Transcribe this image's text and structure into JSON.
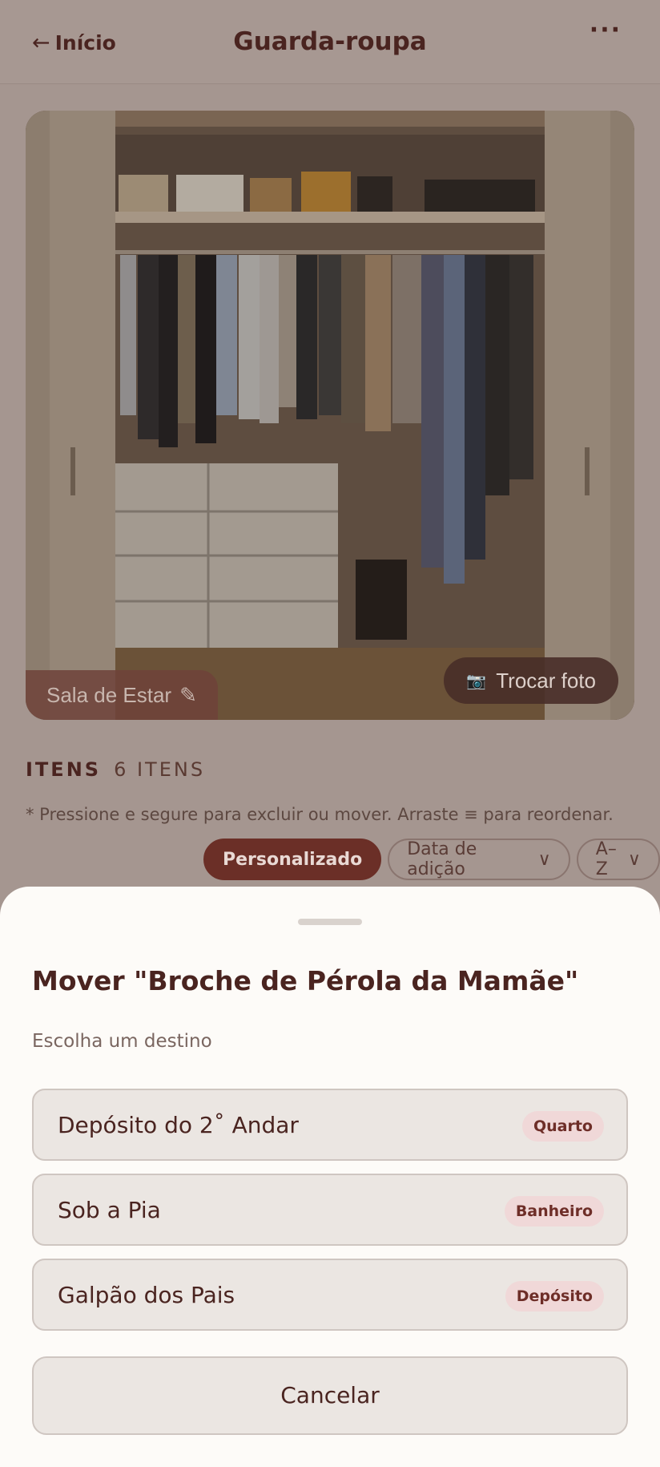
{
  "header": {
    "back_arrow": "←",
    "back_label": "Início",
    "title": "Guarda-roupa",
    "more_label": "···"
  },
  "photo": {
    "room_label": "Sala de Estar",
    "edit_icon": "✎",
    "camera_icon": "📷",
    "change_photo_label": "Trocar foto"
  },
  "items": {
    "heading": "ITENS",
    "count": "6 ITENS",
    "hint": "* Pressione e segure para excluir ou mover. Arraste ≡ para reordenar."
  },
  "sort": {
    "custom": "Personalizado",
    "date_added": "Data de adição",
    "date_arrow": "∨",
    "alpha": "A–Z",
    "alpha_arrow": "∨"
  },
  "sheet": {
    "title": "Mover \"Broche de Pérola da Mamãe\"",
    "subtitle": "Escolha um destino",
    "destinations": [
      {
        "name": "Depósito do 2˚ Andar",
        "tag": "Quarto"
      },
      {
        "name": "Sob a Pia",
        "tag": "Banheiro"
      },
      {
        "name": "Galpão dos Pais",
        "tag": "Depósito"
      }
    ],
    "cancel_label": "Cancelar"
  },
  "colors": {
    "accent": "#6b2f27",
    "text": "#4a2420",
    "tag_bg": "#f0d8d8",
    "overlay_bg": "#a59690",
    "sheet_bg": "#fdfbf8"
  }
}
